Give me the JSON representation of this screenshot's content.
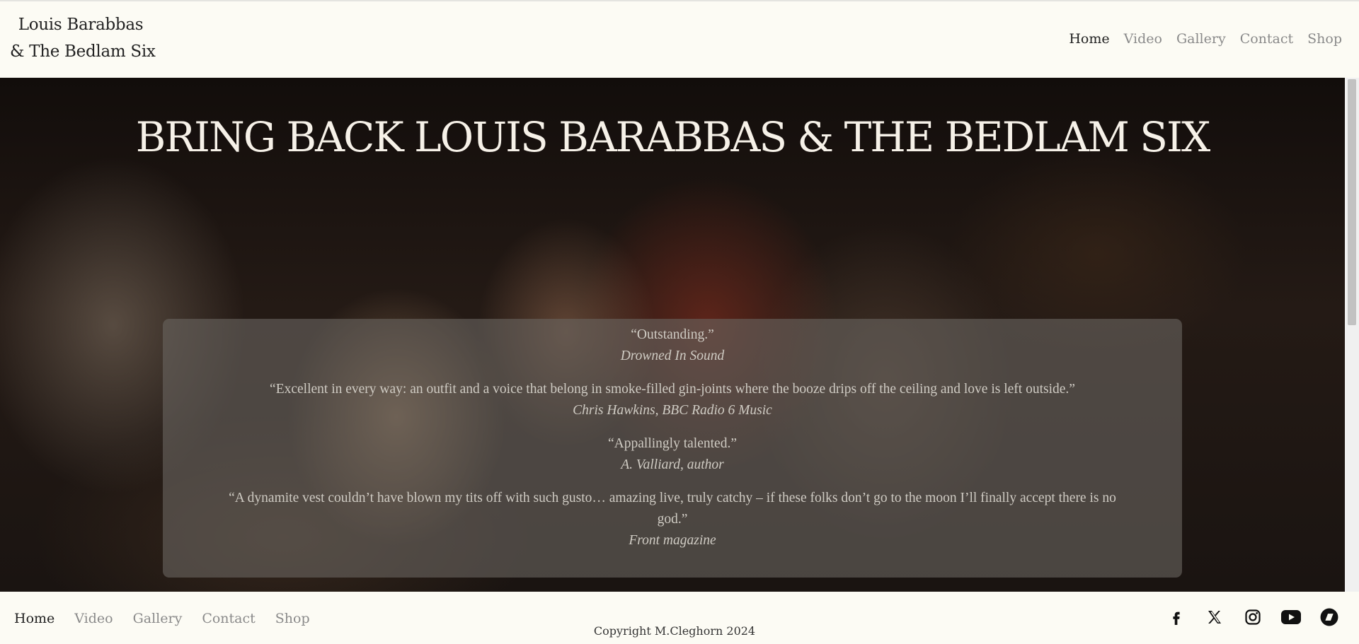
{
  "site": {
    "title_line1": "Louis Barabbas",
    "title_line2": "& The Bedlam Six"
  },
  "nav": {
    "items": [
      {
        "label": "Home",
        "active": true
      },
      {
        "label": "Video",
        "active": false
      },
      {
        "label": "Gallery",
        "active": false
      },
      {
        "label": "Contact",
        "active": false
      },
      {
        "label": "Shop",
        "active": false
      }
    ]
  },
  "hero": {
    "title": "BRING BACK LOUIS BARABBAS & THE BEDLAM SIX",
    "quotes": [
      {
        "text": "“Outstanding.”",
        "source": "Drowned In Sound"
      },
      {
        "text": "“Excellent in every way: an outfit and a voice that belong in smoke-filled gin-joints where the booze drips off the ceiling and love is left outside.”",
        "source": "Chris Hawkins, BBC Radio 6 Music"
      },
      {
        "text": "“Appallingly talented.”",
        "source": "A. Valliard, author"
      },
      {
        "text": "“A dynamite vest couldn’t have blown my tits off with such gusto… amazing live, truly catchy – if these folks don’t go to the moon I’ll finally accept there is no god.”",
        "source": "Front magazine"
      }
    ]
  },
  "footer": {
    "nav": [
      {
        "label": "Home",
        "active": true
      },
      {
        "label": "Video",
        "active": false
      },
      {
        "label": "Gallery",
        "active": false
      },
      {
        "label": "Contact",
        "active": false
      },
      {
        "label": "Shop",
        "active": false
      }
    ],
    "copyright": "Copyright M.Cleghorn 2024",
    "social_icons": [
      "facebook-icon",
      "x-icon",
      "instagram-icon",
      "youtube-icon",
      "bandcamp-icon"
    ]
  },
  "colors": {
    "page_bg": "#fcfbf4",
    "nav_active": "#222222",
    "nav_inactive": "#8a8a8a",
    "hero_title": "#f6f1e8",
    "quote_text": "#cfcbc3"
  }
}
